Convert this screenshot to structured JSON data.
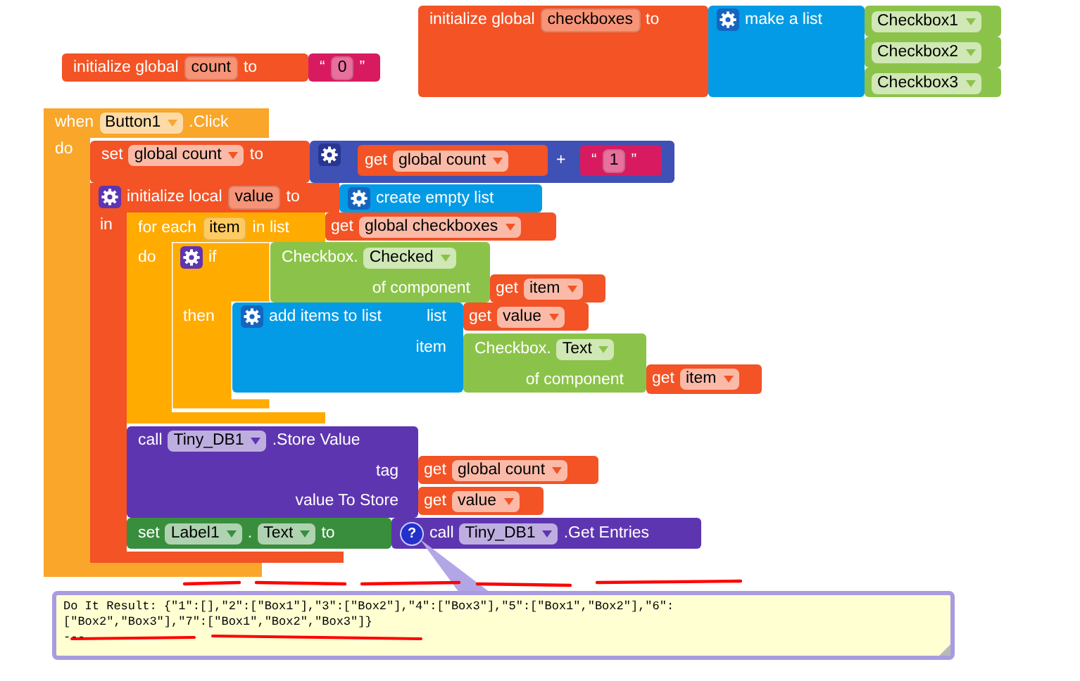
{
  "blocks": [
    {
      "kind": "variable",
      "head": [
        {
          "kind": "label",
          "text": "initialize global"
        },
        {
          "kind": "field",
          "text": "count"
        },
        {
          "kind": "label",
          "text": "to"
        }
      ],
      "inputs": [
        {
          "block": {
            "kind": "text",
            "head": [
              {
                "kind": "label",
                "text": "“"
              },
              {
                "kind": "field",
                "text": "0"
              },
              {
                "kind": "label",
                "text": "”"
              }
            ]
          }
        }
      ]
    },
    {
      "kind": "variable",
      "head": [
        {
          "kind": "label",
          "text": "initialize global"
        },
        {
          "kind": "field",
          "text": "checkboxes"
        },
        {
          "kind": "label",
          "text": "to"
        }
      ],
      "inputs": [
        {
          "block": {
            "kind": "list",
            "head": [
              {
                "kind": "gear"
              },
              {
                "kind": "label",
                "text": "make a list"
              }
            ],
            "inputs": [
              {
                "block": {
                  "kind": "component",
                  "head": [
                    {
                      "kind": "dropdown",
                      "text": "Checkbox1"
                    }
                  ]
                }
              },
              {
                "block": {
                  "kind": "component",
                  "head": [
                    {
                      "kind": "dropdown",
                      "text": "Checkbox2"
                    }
                  ]
                }
              },
              {
                "block": {
                  "kind": "component",
                  "head": [
                    {
                      "kind": "dropdown",
                      "text": "Checkbox3"
                    }
                  ]
                }
              }
            ]
          }
        }
      ]
    },
    {
      "kind": "event",
      "head": [
        {
          "kind": "label",
          "text": "when"
        },
        {
          "kind": "dropdown",
          "text": "Button1"
        },
        {
          "kind": "label",
          "text": ".Click"
        }
      ],
      "body_label": "do",
      "body": [
        {
          "kind": "variable",
          "head": [
            {
              "kind": "label",
              "text": "set"
            },
            {
              "kind": "dropdown",
              "text": "global count"
            },
            {
              "kind": "label",
              "text": "to"
            }
          ],
          "inputs": [
            {
              "block": {
                "kind": "math",
                "head": [
                  {
                    "kind": "gear"
                  }
                ],
                "inputs": [
                  {
                    "block": {
                      "kind": "variable",
                      "head": [
                        {
                          "kind": "label",
                          "text": "get"
                        },
                        {
                          "kind": "dropdown",
                          "text": "global count"
                        }
                      ]
                    }
                  },
                  {
                    "label": "+",
                    "block": {
                      "kind": "text",
                      "head": [
                        {
                          "kind": "label",
                          "text": "“"
                        },
                        {
                          "kind": "field",
                          "text": "1"
                        },
                        {
                          "kind": "label",
                          "text": "”"
                        }
                      ]
                    }
                  }
                ]
              }
            }
          ]
        },
        {
          "kind": "variable",
          "head": [
            {
              "kind": "gear"
            },
            {
              "kind": "label",
              "text": "initialize local"
            },
            {
              "kind": "field",
              "text": "value"
            },
            {
              "kind": "label",
              "text": "to"
            }
          ],
          "inputs": [
            {
              "block": {
                "kind": "list",
                "head": [
                  {
                    "kind": "gear"
                  },
                  {
                    "kind": "label",
                    "text": "create empty list"
                  }
                ]
              }
            }
          ],
          "body_label": "in",
          "body": [
            {
              "kind": "control",
              "head": [
                {
                  "kind": "label",
                  "text": "for each"
                },
                {
                  "kind": "field",
                  "text": "item"
                },
                {
                  "kind": "label",
                  "text": "in list"
                }
              ],
              "inputs": [
                {
                  "block": {
                    "kind": "variable",
                    "head": [
                      {
                        "kind": "label",
                        "text": "get"
                      },
                      {
                        "kind": "dropdown",
                        "text": "global checkboxes"
                      }
                    ]
                  }
                }
              ],
              "body_label": "do",
              "body": [
                {
                  "kind": "control",
                  "head": [
                    {
                      "kind": "gear"
                    },
                    {
                      "kind": "label",
                      "text": "if"
                    }
                  ],
                  "inputs": [
                    {
                      "block": {
                        "kind": "component",
                        "head": [
                          {
                            "kind": "label",
                            "text": "Checkbox."
                          },
                          {
                            "kind": "dropdown",
                            "text": "Checked"
                          }
                        ],
                        "inputs": [
                          {
                            "label": "of component",
                            "block": {
                              "kind": "variable",
                              "head": [
                                {
                                  "kind": "label",
                                  "text": "get"
                                },
                                {
                                  "kind": "dropdown",
                                  "text": "item"
                                }
                              ]
                            }
                          }
                        ]
                      }
                    }
                  ],
                  "body_label": "then",
                  "body": [
                    {
                      "kind": "list",
                      "head": [
                        {
                          "kind": "gear"
                        },
                        {
                          "kind": "label",
                          "text": "add items to list"
                        }
                      ],
                      "inputs": [
                        {
                          "label": "list",
                          "block": {
                            "kind": "variable",
                            "head": [
                              {
                                "kind": "label",
                                "text": "get"
                              },
                              {
                                "kind": "dropdown",
                                "text": "value"
                              }
                            ]
                          }
                        },
                        {
                          "label": "item",
                          "block": {
                            "kind": "component",
                            "head": [
                              {
                                "kind": "label",
                                "text": "Checkbox."
                              },
                              {
                                "kind": "dropdown",
                                "text": "Text"
                              }
                            ],
                            "inputs": [
                              {
                                "label": "of component",
                                "block": {
                                  "kind": "variable",
                                  "head": [
                                    {
                                      "kind": "label",
                                      "text": "get"
                                    },
                                    {
                                      "kind": "dropdown",
                                      "text": "item"
                                    }
                                  ]
                                }
                              }
                            ]
                          }
                        }
                      ]
                    }
                  ]
                }
              ]
            },
            {
              "kind": "database",
              "head": [
                {
                  "kind": "label",
                  "text": "call"
                },
                {
                  "kind": "dropdown",
                  "text": "Tiny_DB1"
                },
                {
                  "kind": "label",
                  "text": ".Store Value"
                }
              ],
              "inputs": [
                {
                  "label": "tag",
                  "block": {
                    "kind": "variable",
                    "head": [
                      {
                        "kind": "label",
                        "text": "get"
                      },
                      {
                        "kind": "dropdown",
                        "text": "global count"
                      }
                    ]
                  }
                },
                {
                  "label": "value To Store",
                  "block": {
                    "kind": "variable",
                    "head": [
                      {
                        "kind": "label",
                        "text": "get"
                      },
                      {
                        "kind": "dropdown",
                        "text": "value"
                      }
                    ]
                  }
                }
              ]
            },
            {
              "kind": "setter",
              "head": [
                {
                  "kind": "label",
                  "text": "set"
                },
                {
                  "kind": "dropdown",
                  "text": "Label1"
                },
                {
                  "kind": "label",
                  "text": "."
                },
                {
                  "kind": "dropdown",
                  "text": "Text"
                },
                {
                  "kind": "label",
                  "text": "to"
                }
              ],
              "inputs": [
                {
                  "block": {
                    "kind": "database",
                    "head": [
                      {
                        "kind": "help",
                        "text": "?"
                      },
                      {
                        "kind": "label",
                        "text": "call"
                      },
                      {
                        "kind": "dropdown",
                        "text": "Tiny_DB1"
                      },
                      {
                        "kind": "label",
                        "text": ".Get Entries"
                      }
                    ]
                  }
                }
              ]
            }
          ]
        }
      ]
    }
  ],
  "comment": {
    "lines": [
      "Do It Result: {\"1\":[],\"2\":[\"Box1\"],\"3\":[\"Box2\"],\"4\":[\"Box3\"],\"5\":[\"Box1\",\"Box2\"],\"6\":",
      "[\"Box2\",\"Box3\"],\"7\":[\"Box1\",\"Box2\",\"Box3\"]}",
      "---"
    ]
  }
}
